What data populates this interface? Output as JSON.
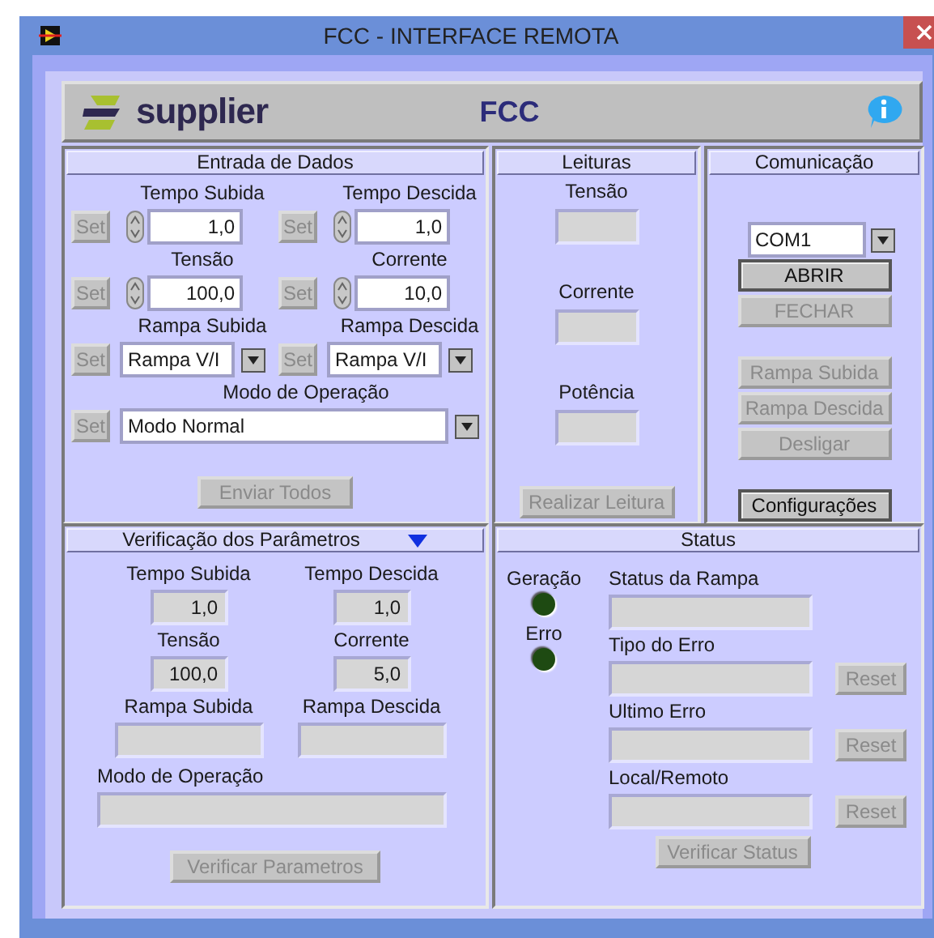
{
  "window": {
    "title": "FCC - INTERFACE REMOTA"
  },
  "header": {
    "logo_text": "supplier",
    "title": "FCC"
  },
  "data_entry": {
    "title": "Entrada de Dados",
    "fields": [
      {
        "kind": "numeric",
        "label": "Tempo Subida",
        "value": "1,0",
        "set_button": {
          "label": "Set",
          "disabled": true
        }
      },
      {
        "kind": "numeric",
        "label": "Tempo Descida",
        "value": "1,0",
        "set_button": {
          "label": "Set",
          "disabled": true
        }
      },
      {
        "kind": "numeric",
        "label": "Tensão",
        "value": "100,0",
        "set_button": {
          "label": "Set",
          "disabled": true
        }
      },
      {
        "kind": "numeric",
        "label": "Corrente",
        "value": "10,0",
        "set_button": {
          "label": "Set",
          "disabled": true
        }
      },
      {
        "kind": "select",
        "label": "Rampa Subida",
        "value": "Rampa V/I",
        "set_button": {
          "label": "Set",
          "disabled": true
        }
      },
      {
        "kind": "select",
        "label": "Rampa Descida",
        "value": "Rampa V/I",
        "set_button": {
          "label": "Set",
          "disabled": true
        }
      },
      {
        "kind": "wide_select",
        "label": "Modo de Operação",
        "value": "Modo Normal",
        "set_button": {
          "label": "Set",
          "disabled": true
        }
      }
    ],
    "send_button": {
      "label": "Enviar Todos",
      "disabled": true
    }
  },
  "readings": {
    "title": "Leituras",
    "items": [
      {
        "label": "Tensão"
      },
      {
        "label": "Corrente"
      },
      {
        "label": "Potência"
      }
    ],
    "button": {
      "label": "Realizar Leitura",
      "disabled": true
    }
  },
  "communication": {
    "title": "Comunicação",
    "port": "COM1",
    "button_groups": [
      {
        "buttons": [
          {
            "label": "ABRIR",
            "disabled": false
          },
          {
            "label": "FECHAR",
            "disabled": true
          }
        ]
      },
      {
        "buttons": [
          {
            "label": "Rampa Subida",
            "disabled": true
          },
          {
            "label": "Rampa Descida",
            "disabled": true
          },
          {
            "label": "Desligar",
            "disabled": true
          }
        ]
      },
      {
        "buttons": [
          {
            "label": "Configurações",
            "disabled": false
          }
        ]
      }
    ]
  },
  "verification": {
    "title": "Verificação dos Parâmetros",
    "fields": [
      {
        "kind": "number",
        "label": "Tempo Subida",
        "value": "1,0"
      },
      {
        "kind": "number",
        "label": "Tempo Descida",
        "value": "1,0"
      },
      {
        "kind": "number",
        "label": "Tensão",
        "value": "100,0"
      },
      {
        "kind": "number",
        "label": "Corrente",
        "value": "5,0"
      },
      {
        "kind": "text",
        "label": "Rampa Subida"
      },
      {
        "kind": "text",
        "label": "Rampa Descida"
      },
      {
        "kind": "long",
        "label": "Modo de Operação"
      }
    ],
    "button": {
      "label": "Verificar Parametros",
      "disabled": true
    }
  },
  "status": {
    "title": "Status",
    "indicators": [
      {
        "label": "Geração",
        "on": false
      },
      {
        "label": "Erro",
        "on": false
      }
    ],
    "fields": [
      {
        "label": "Status da Rampa"
      },
      {
        "label": "Tipo do Erro",
        "reset_button": {
          "label": "Reset",
          "disabled": true
        }
      },
      {
        "label": "Ultimo Erro",
        "reset_button": {
          "label": "Reset",
          "disabled": true
        }
      },
      {
        "label": "Local/Remoto",
        "reset_button": {
          "label": "Reset",
          "disabled": true
        }
      }
    ],
    "button": {
      "label": "Verificar Status",
      "disabled": true
    }
  }
}
